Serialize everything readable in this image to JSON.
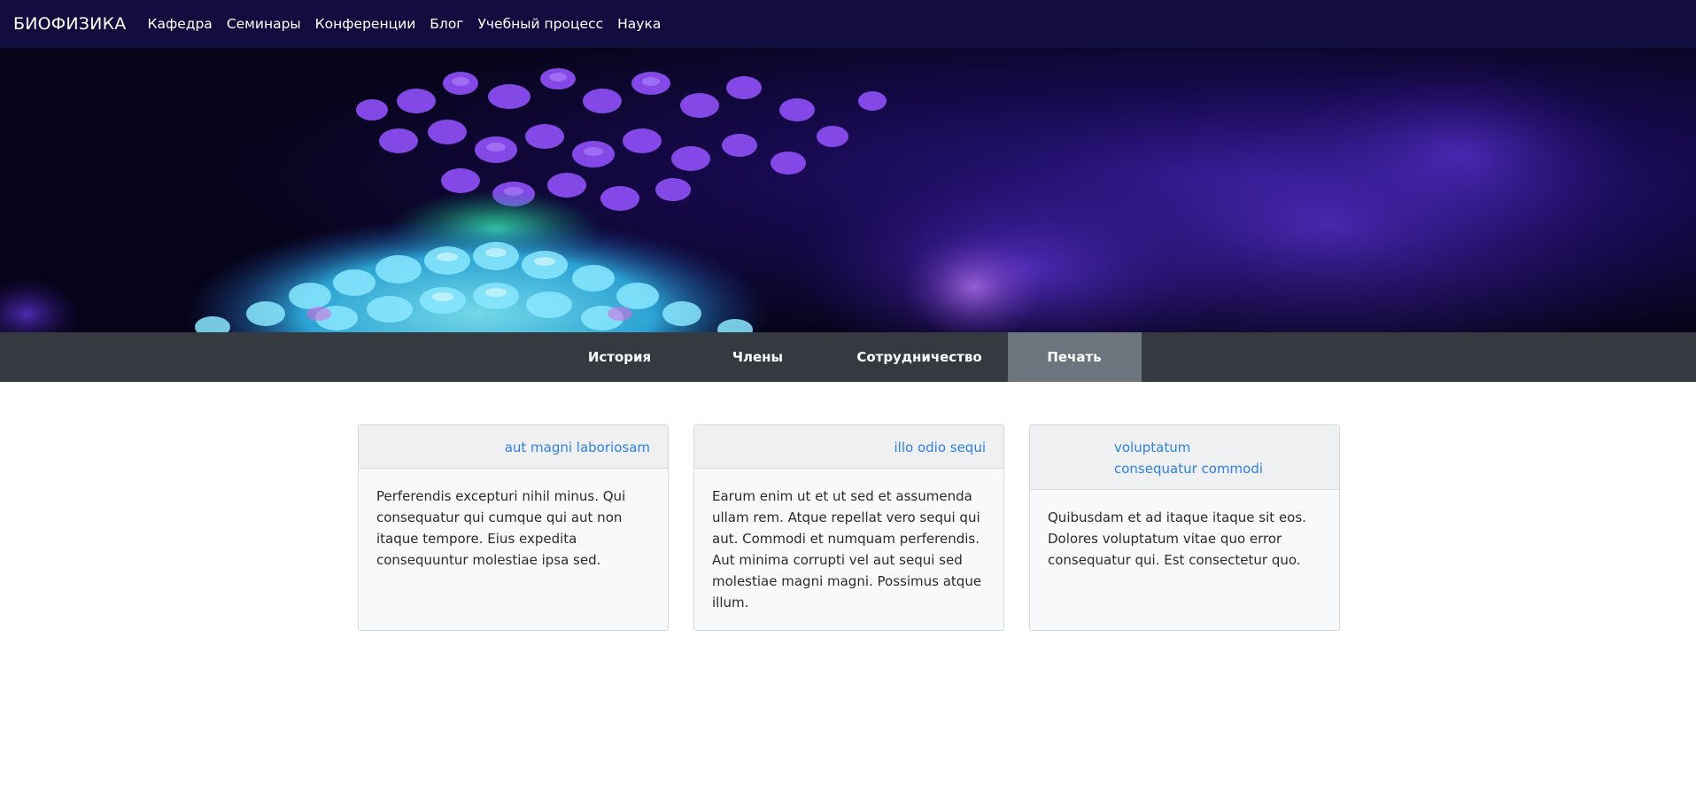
{
  "navbar": {
    "brand": "БИОФИЗИКА",
    "links": [
      "Кафедра",
      "Семинары",
      "Конференции",
      "Блог",
      "Учебный процесс",
      "Наука"
    ]
  },
  "tabs": [
    {
      "label": "История",
      "active": false
    },
    {
      "label": "Члены",
      "active": false
    },
    {
      "label": "Сотрудничество",
      "active": false
    },
    {
      "label": "Печать",
      "active": true
    }
  ],
  "cards": [
    {
      "title": "aut magni laboriosam",
      "body": "Perferendis excepturi nihil minus. Qui consequatur qui cumque qui aut non itaque tempore. Eius expedita consequuntur molestiae ipsa sed."
    },
    {
      "title": "illo odio sequi",
      "body": "Earum enim ut et ut sed et assumenda ullam rem. Atque repellat vero sequi qui aut. Commodi et numquam perferendis. Aut minima corrupti vel aut sequi sed molestiae magni magni. Possimus atque illum."
    },
    {
      "title": "voluptatum consequatur commodi",
      "body": "Quibusdam et ad itaque itaque sit eos. Dolores voluptatum vitae quo error consequatur qui. Est consectetur quo."
    }
  ],
  "colors": {
    "navbar_bg": "#130c3e",
    "tabbar_bg": "#343a40",
    "tab_active_bg": "#6c757d",
    "link": "#2f80e0"
  }
}
